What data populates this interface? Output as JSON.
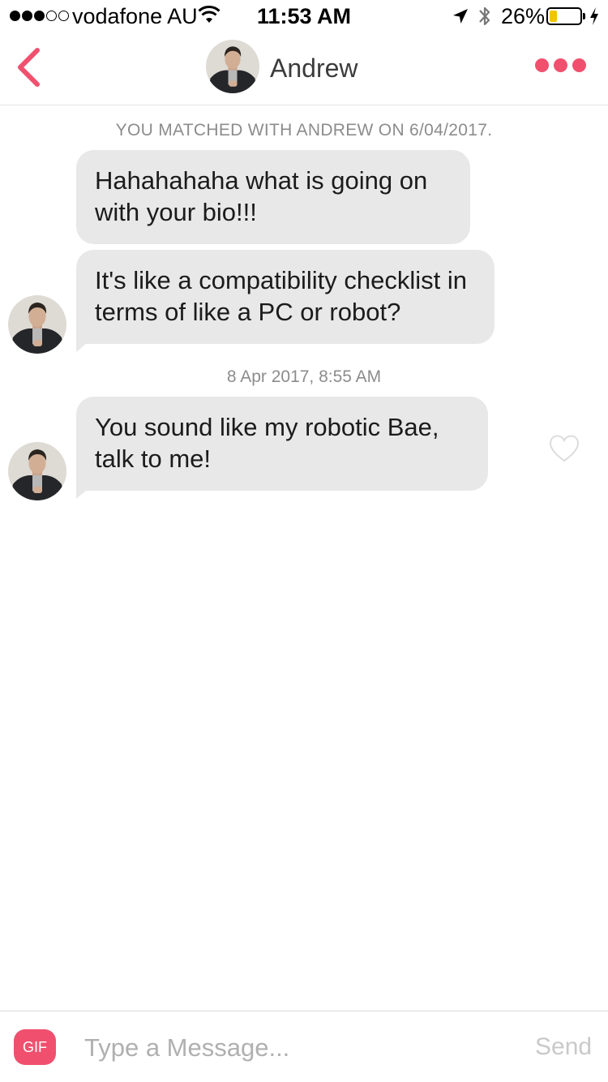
{
  "status_bar": {
    "signal_bars_filled": 3,
    "signal_bars_total": 5,
    "carrier": "vodafone AU",
    "time": "11:53 AM",
    "battery_percent": "26%",
    "battery_level": 0.26,
    "battery_color": "#f2c500"
  },
  "header": {
    "back_icon": "chevron-left-icon",
    "contact_name": "Andrew",
    "more_icon": "ellipsis-icon",
    "accent_color": "#f0506e"
  },
  "conversation": {
    "match_notice": "YOU MATCHED WITH ANDREW ON 6/04/2017.",
    "messages": [
      {
        "sender": "Andrew",
        "text": "Hahahahaha what is going on with your bio!!!"
      },
      {
        "sender": "Andrew",
        "text": "It's like a compatibility checklist in terms of like a PC or robot?"
      },
      {
        "sender": "Andrew",
        "text": "You sound like my robotic Bae, talk to me!"
      }
    ],
    "timestamp": "8 Apr 2017, 8:55 AM",
    "like_icon": "heart-outline-icon"
  },
  "composer": {
    "gif_label": "GIF",
    "placeholder": "Type a Message...",
    "value": "",
    "send_label": "Send"
  }
}
